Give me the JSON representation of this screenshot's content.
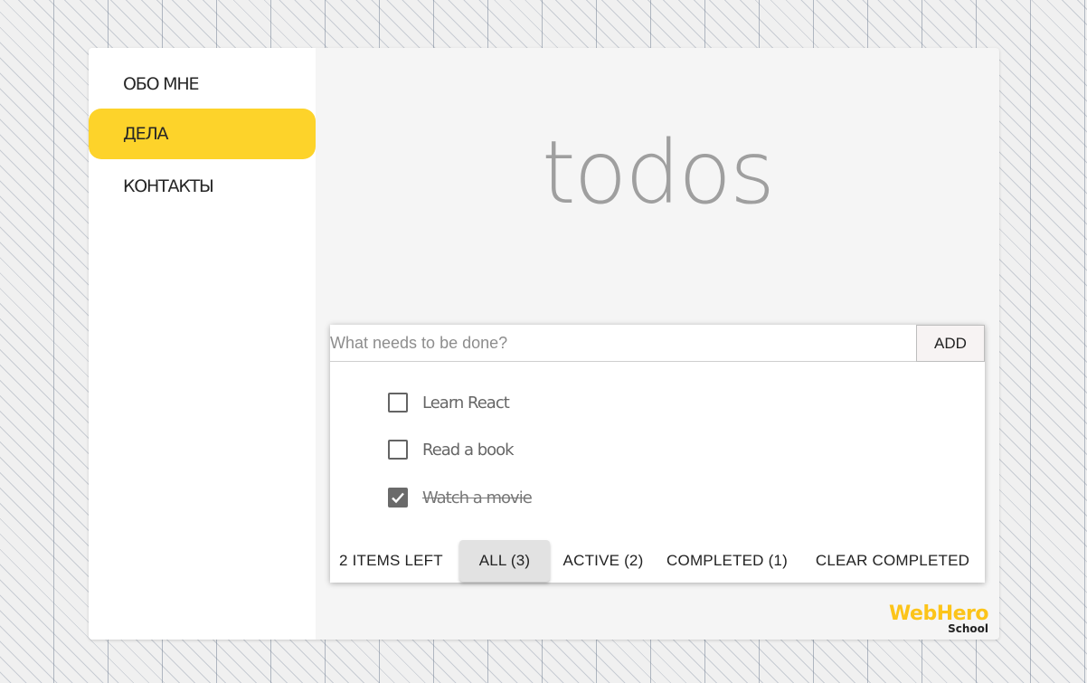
{
  "sidebar": {
    "items": [
      {
        "label": "ОБО МНЕ"
      },
      {
        "label": "ДЕЛА"
      },
      {
        "label": "КОНТАКТЫ"
      }
    ]
  },
  "main": {
    "title": "todos",
    "new_todo": {
      "placeholder": "What needs to be done?",
      "value": "",
      "add_label": "ADD"
    },
    "todos": [
      {
        "text": "Learn React",
        "completed": false
      },
      {
        "text": "Read a book",
        "completed": false
      },
      {
        "text": "Watch a movie",
        "completed": true
      }
    ],
    "footer": {
      "items_left": "2 ITEMS LEFT",
      "filters": [
        {
          "label": "ALL (3)",
          "selected": true
        },
        {
          "label": "ACTIVE (2)",
          "selected": false
        },
        {
          "label": "COMPLETED (1)",
          "selected": false
        }
      ],
      "clear_completed": "CLEAR COMPLETED"
    }
  },
  "branding": {
    "logo_main": "WebHero",
    "logo_sub": "School",
    "accent_color": "#fdd32a"
  }
}
